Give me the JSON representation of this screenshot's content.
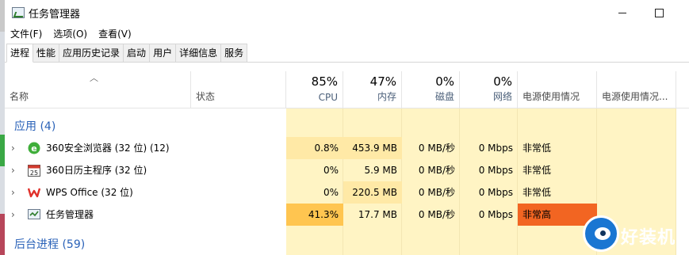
{
  "window": {
    "title": "任务管理器"
  },
  "menu": {
    "items": [
      "文件(F)",
      "选项(O)",
      "查看(V)"
    ]
  },
  "tabs": [
    "进程",
    "性能",
    "应用历史记录",
    "启动",
    "用户",
    "详细信息",
    "服务"
  ],
  "columns": {
    "name": "名称",
    "status": "状态",
    "cpu": {
      "pct": "85%",
      "label": "CPU"
    },
    "memory": {
      "pct": "47%",
      "label": "内存"
    },
    "disk": {
      "pct": "0%",
      "label": "磁盘"
    },
    "network": {
      "pct": "0%",
      "label": "网络"
    },
    "power": "电源使用情况",
    "power_trend": "电源使用情况..."
  },
  "groups": {
    "apps": "应用 (4)",
    "background": "后台进程 (59)"
  },
  "rows": [
    {
      "name": "360安全浏览器 (32 位) (12)",
      "icon": "browser-360-icon",
      "cpu": "0.8%",
      "memory": "453.9 MB",
      "disk": "0 MB/秒",
      "network": "0 Mbps",
      "power": "非常低"
    },
    {
      "name": "360日历主程序 (32 位)",
      "icon": "calendar-icon",
      "cpu": "0%",
      "memory": "5.9 MB",
      "disk": "0 MB/秒",
      "network": "0 Mbps",
      "power": "非常低"
    },
    {
      "name": "WPS Office (32 位)",
      "icon": "wps-icon",
      "cpu": "0%",
      "memory": "220.5 MB",
      "disk": "0 MB/秒",
      "network": "0 Mbps",
      "power": "非常低"
    },
    {
      "name": "任务管理器",
      "icon": "task-manager-icon",
      "cpu": "41.3%",
      "memory": "17.7 MB",
      "disk": "0 MB/秒",
      "network": "0 Mbps",
      "power": "非常高"
    }
  ],
  "calendar_icon_text": "25",
  "watermark": {
    "text": "好装机"
  },
  "colors": {
    "accent": "#2a62b8",
    "heat_light": "#fff4c4",
    "heat_med": "#ffe9a6",
    "heat_strong": "#ffc550",
    "power_very_high": "#f26522"
  }
}
